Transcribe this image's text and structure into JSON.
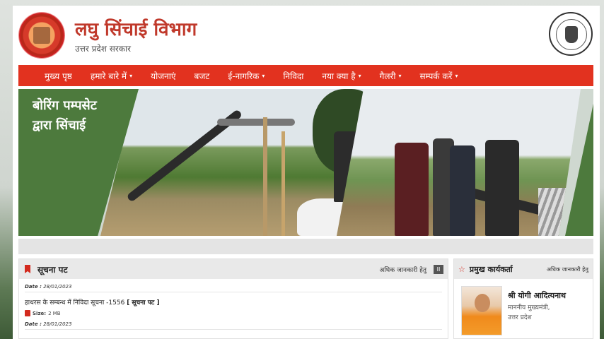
{
  "header": {
    "title": "लघु सिंचाई विभाग",
    "subtitle": "उत्तर प्रदेश सरकार"
  },
  "nav": {
    "items": [
      {
        "label": "मुख्य पृष्ठ",
        "dropdown": false
      },
      {
        "label": "हमारे बारे में",
        "dropdown": true
      },
      {
        "label": "योजनाएं",
        "dropdown": false
      },
      {
        "label": "बजट",
        "dropdown": false
      },
      {
        "label": "ई-नागरिक",
        "dropdown": true
      },
      {
        "label": "निविदा",
        "dropdown": false
      },
      {
        "label": "नया क्या है",
        "dropdown": true
      },
      {
        "label": "गैलरी",
        "dropdown": true
      },
      {
        "label": "सम्पर्क करें",
        "dropdown": true
      }
    ],
    "caret": "▾"
  },
  "banner": {
    "caption_line1": "बोरिंग पम्पसेट",
    "caption_line2": "द्वारा सिंचाई"
  },
  "notice": {
    "title": "सूचना पट",
    "more_label": "अधिक जानकारी हेतु",
    "pause_symbol": "II",
    "items": [
      {
        "date_label": "Date :",
        "date": "28/01/2023",
        "title": "हाथरस के सम्बन्ध में निविदा सूचना -1556",
        "tag": "[ सूचना पट ]",
        "size_label": "Size:",
        "size": "2 MB"
      },
      {
        "date_label": "Date :",
        "date": "28/01/2023"
      }
    ]
  },
  "officer": {
    "title": "प्रमुख कार्यकर्ता",
    "more_label": "अधिक जानकारी हेतु",
    "name": "श्री योगी आदित्यनाथ",
    "role_line1": "माननीय मुख्यमंत्री,",
    "role_line2": "उत्तर प्रदेश"
  },
  "colors": {
    "accent_red": "#e2321f",
    "title_red": "#c0392b",
    "banner_green": "#4d7a3d"
  },
  "icons": [
    "department-logo",
    "up-govt-emblem",
    "flag-icon",
    "pause-icon",
    "pdf-icon",
    "star-icon"
  ]
}
